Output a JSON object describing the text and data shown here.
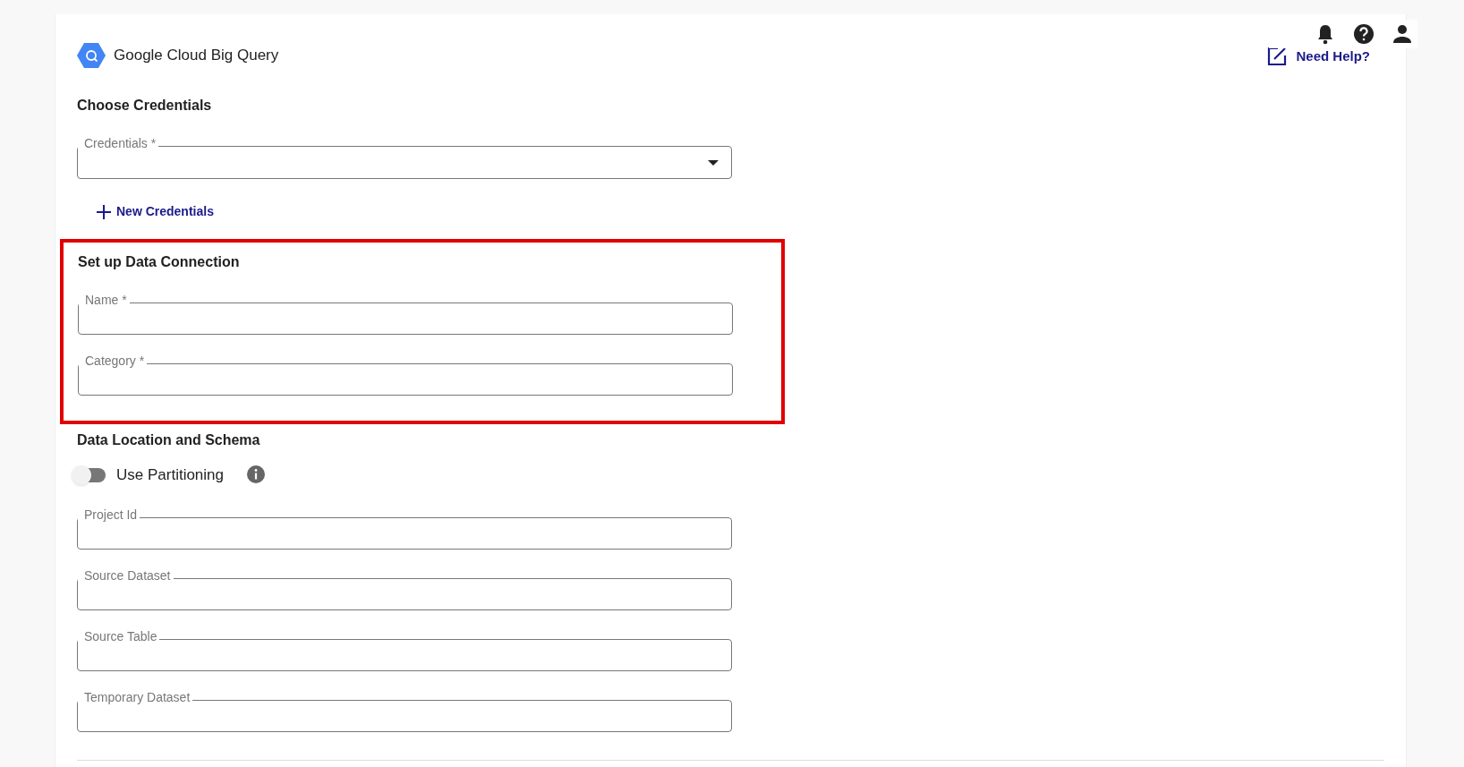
{
  "header": {
    "title": "Google Cloud Big Query",
    "help_link": "Need Help?"
  },
  "credentials": {
    "heading": "Choose Credentials",
    "field": {
      "label": "Credentials *",
      "kind": "select"
    },
    "add_button": "New Credentials"
  },
  "connection": {
    "heading": "Set up Data Connection",
    "highlighted": true,
    "fields": [
      {
        "label": "Name *",
        "kind": "text"
      },
      {
        "label": "Category *",
        "kind": "text"
      }
    ]
  },
  "location": {
    "heading": "Data Location and Schema",
    "toggle": {
      "label": "Use Partitioning",
      "on": false
    },
    "fields": [
      {
        "label": "Project Id",
        "kind": "text"
      },
      {
        "label": "Source Dataset",
        "kind": "text"
      },
      {
        "label": "Source Table",
        "kind": "text"
      },
      {
        "label": "Temporary Dataset",
        "kind": "text"
      }
    ]
  }
}
